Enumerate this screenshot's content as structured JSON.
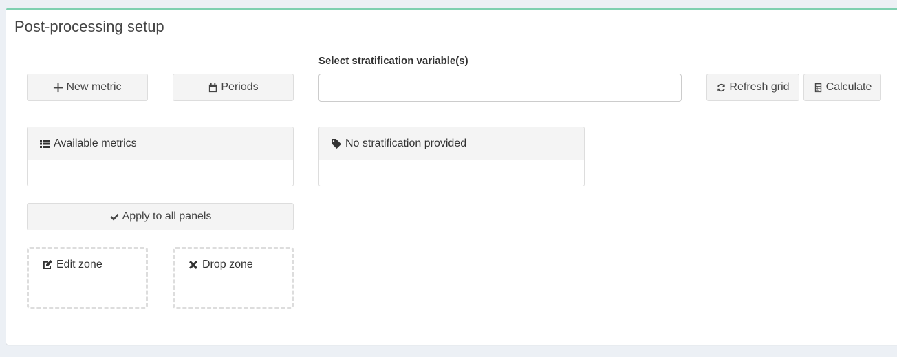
{
  "box": {
    "title": "Post-processing setup",
    "accent": "#7fd0b0"
  },
  "toolbar": {
    "new_metric": "New metric",
    "periods": "Periods",
    "refresh_grid": "Refresh grid",
    "calculate": "Calculate"
  },
  "stratification": {
    "label": "Select stratification variable(s)",
    "value": "",
    "placeholder": ""
  },
  "panels": {
    "available_metrics": {
      "title": "Available metrics",
      "icon": "list-icon"
    },
    "stratification": {
      "title": "No stratification provided",
      "icon": "tag-icon"
    }
  },
  "apply_all": {
    "label": "Apply to all panels",
    "icon": "check-icon"
  },
  "zones": {
    "edit": {
      "label": "Edit zone",
      "icon": "edit-icon"
    },
    "drop": {
      "label": "Drop zone",
      "icon": "times-icon"
    }
  }
}
